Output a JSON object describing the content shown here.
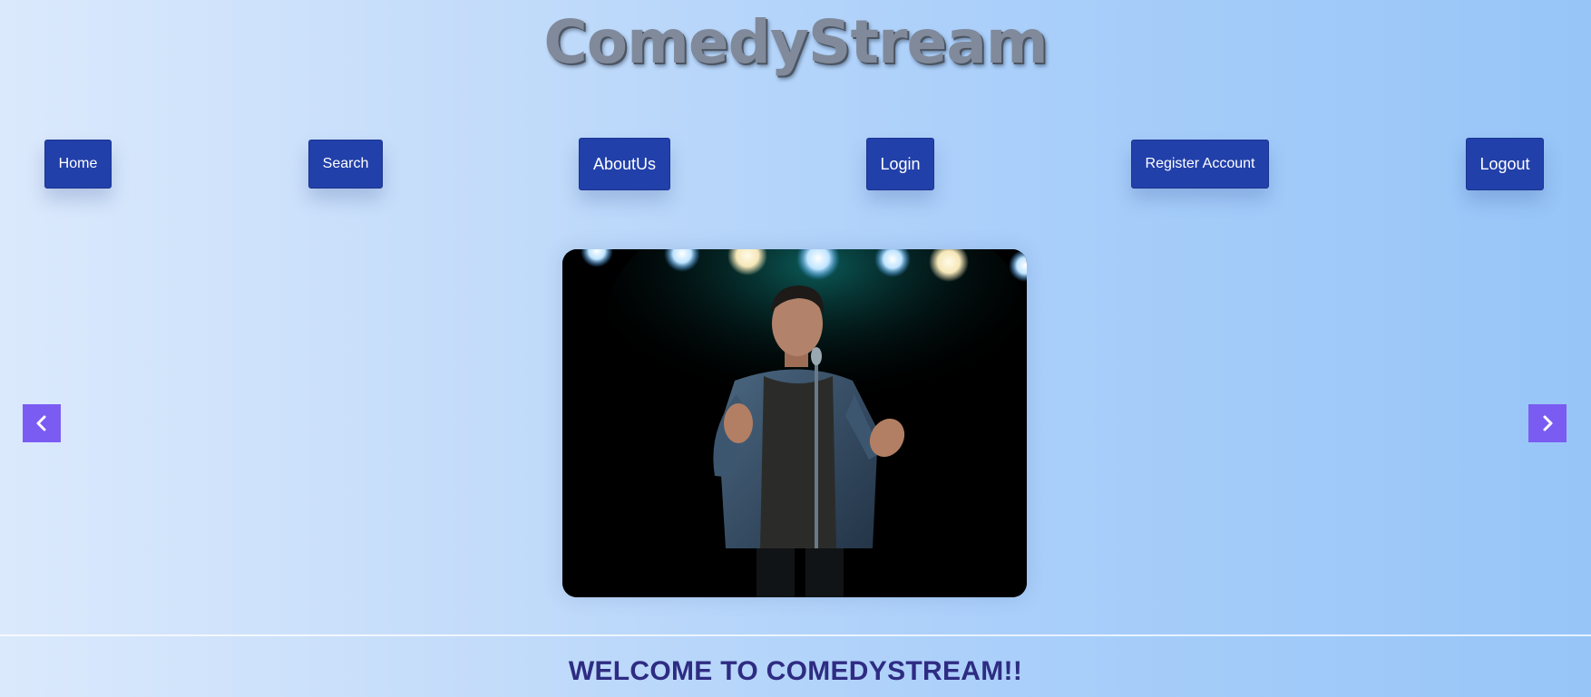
{
  "site": {
    "title": "ComedyStream"
  },
  "nav": {
    "home": "Home",
    "search": "Search",
    "about": "AboutUs",
    "login": "Login",
    "register": "Register Account",
    "logout": "Logout"
  },
  "carousel": {
    "prev_icon": "chevron-left-icon",
    "next_icon": "chevron-right-icon",
    "image": "stand-up-comedian-on-stage-photo"
  },
  "welcome": {
    "heading": "WELCOME TO COMEDYSTREAM!!"
  },
  "colors": {
    "nav_button": "#2240aa",
    "arrow_button": "#7b5cf2",
    "heading": "#2e2c82"
  }
}
